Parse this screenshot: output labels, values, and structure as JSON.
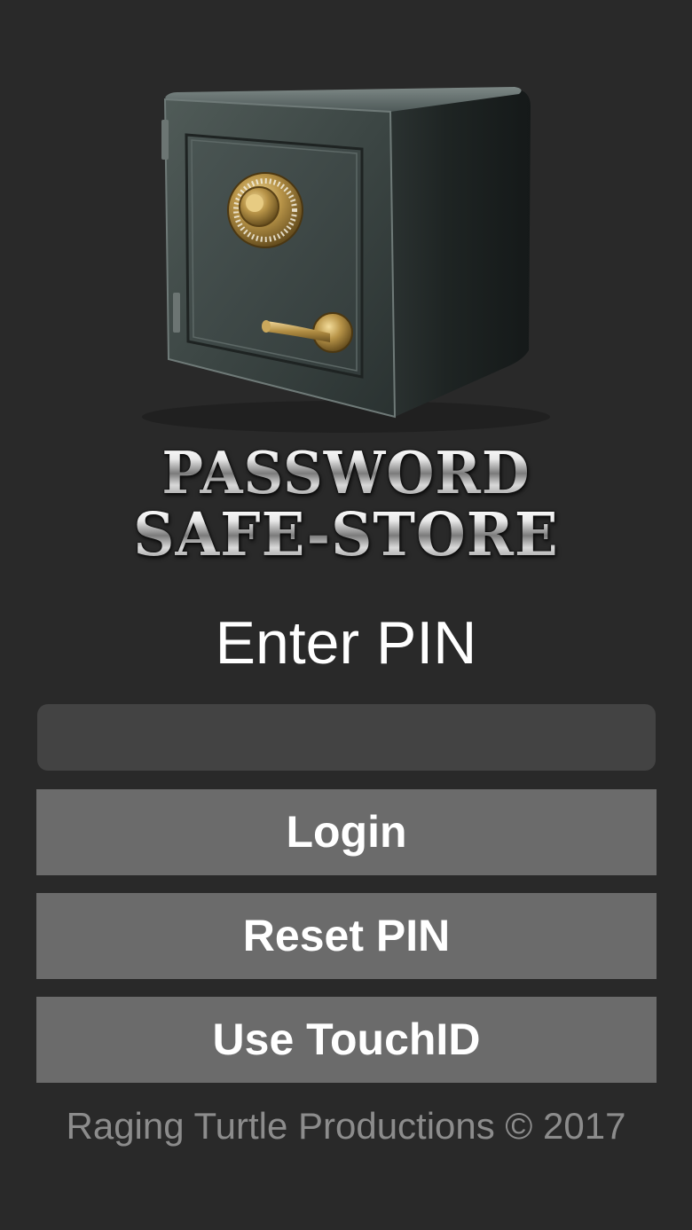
{
  "logo": {
    "line1": "PASSWORD",
    "line2": "SAFE-STORE",
    "safe_icon": "safe-icon"
  },
  "login": {
    "heading": "Enter PIN",
    "pin_value": "",
    "pin_placeholder": ""
  },
  "buttons": {
    "login_label": "Login",
    "reset_pin_label": "Reset PIN",
    "touchid_label": "Use TouchID"
  },
  "footer": {
    "text": "Raging Turtle Productions © 2017"
  },
  "colors": {
    "background": "#292929",
    "input_bg": "#434343",
    "button_bg": "#6b6b6b",
    "button_text": "#ffffff",
    "footer_text": "#8c8c8c"
  }
}
